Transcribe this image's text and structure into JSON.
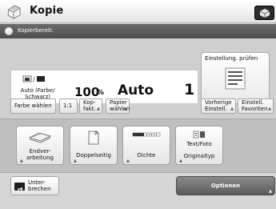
{
  "header": {
    "title": "Kopie",
    "app_icon": "copy-machine-icon",
    "corner_icon": "cube-icon"
  },
  "status": {
    "text": "Kopierbereit.",
    "icon": "status-dot-icon"
  },
  "settings": {
    "color_mode": "Auto (Farbe/\nSchwarz)",
    "zoom": "100",
    "zoom_unit": "%",
    "paper": "Auto",
    "copies": "1"
  },
  "preview_button": {
    "label": "Einstellung. prüfen",
    "icon": "document-icon"
  },
  "buttons": {
    "color_select": "Farbe wählen",
    "one_to_one": "1:1",
    "copy_ratio": "Kop-\nfakt.",
    "paper_select": "Papier\nwählen",
    "previous_settings": "Vorherige\nEinstell.",
    "favorites": "Einstell.\nFavoriten"
  },
  "functions": {
    "finishing": "Endver-\narbeitung",
    "duplex": "Doppelseitig",
    "density": "Dichte",
    "original_type_value": "Text/Foto",
    "original_type": "Originaltyp"
  },
  "bottom": {
    "interrupt": "Unter-\nbrechen",
    "options": "Optionen"
  }
}
